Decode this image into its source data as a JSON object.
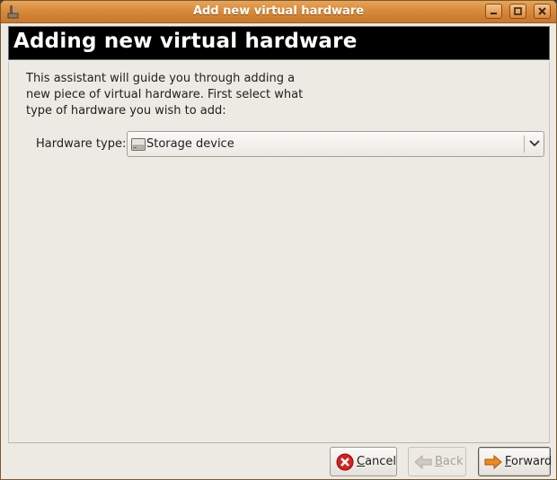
{
  "window": {
    "title": "Add new virtual hardware"
  },
  "header": {
    "heading": "Adding new virtual hardware"
  },
  "intro": {
    "text": "This assistant will guide you through adding a new piece of virtual hardware. First select what type of hardware you wish to add:"
  },
  "hardware_type": {
    "label": "Hardware type:",
    "selected": "Storage device",
    "icon": "storage-device-icon"
  },
  "buttons": {
    "cancel": {
      "mnemonic": "C",
      "rest": "ancel",
      "icon": "cancel-icon"
    },
    "back": {
      "mnemonic": "B",
      "rest": "ack",
      "icon": "back-arrow-icon",
      "enabled": false
    },
    "forward": {
      "mnemonic": "F",
      "rest": "orward",
      "icon": "forward-arrow-icon"
    }
  },
  "colors": {
    "titlebar": "#d88a3a",
    "banner": "#000000",
    "cancel_red": "#d81f1f",
    "forward_orange": "#f08a1e"
  }
}
